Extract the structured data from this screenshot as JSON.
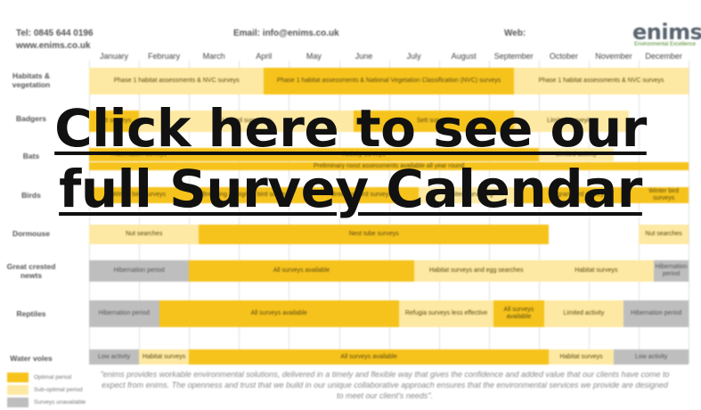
{
  "header": {
    "tel": "Tel: 0845 644 0196",
    "web_url": "www.enims.co.uk",
    "email": "Email: info@enims.co.uk",
    "web_label": "Web:",
    "logo": "enims",
    "logo_sub": "Environmental Excellence"
  },
  "months": [
    "January",
    "February",
    "March",
    "April",
    "May",
    "June",
    "July",
    "August",
    "September",
    "October",
    "November",
    "December"
  ],
  "rows": [
    {
      "label": "Habitats & vegetation",
      "cells": [
        {
          "text": "Phase 1 habitat assessments & NVC surveys",
          "kind": "s"
        },
        {
          "text": "Phase 1 habitat assessments & National Vegetation Classification (NVC) surveys",
          "kind": "o"
        },
        {
          "text": "Phase 1 habitat assessments & NVC surveys",
          "kind": "s"
        }
      ]
    },
    {
      "label": "Badgers",
      "cells": [
        {
          "text": "Sett surveys",
          "kind": "o"
        },
        {
          "text": "Limited surveying",
          "kind": "s"
        },
        {
          "text": "Sett surveys",
          "kind": "o"
        },
        {
          "text": "Limited surveying",
          "kind": "s"
        }
      ]
    },
    {
      "label": "Bats",
      "cells": [
        {
          "text": "Hibernation surveys",
          "kind": "o"
        },
        {
          "text": "Activity surveys",
          "kind": "o"
        },
        {
          "text": "Limited activity",
          "kind": "s"
        },
        {
          "text": "Preliminary roost assessments available all year round",
          "kind": "o"
        }
      ]
    },
    {
      "label": "Birds",
      "cells": [
        {
          "text": "Winter bird surveys",
          "kind": "o"
        },
        {
          "text": "Breeding & migrant bird surveys",
          "kind": "o"
        },
        {
          "text": "Breeding bird surveys",
          "kind": "o"
        },
        {
          "text": "Limited surveying",
          "kind": "s"
        },
        {
          "text": "Migrant bird surveys",
          "kind": "o"
        },
        {
          "text": "Winter bird surveys",
          "kind": "o"
        }
      ]
    },
    {
      "label": "Dormouse",
      "cells": [
        {
          "text": "Nut searches",
          "kind": "s"
        },
        {
          "text": "Nest tube surveys",
          "kind": "o"
        },
        {
          "text": "Nut searches",
          "kind": "s"
        }
      ]
    },
    {
      "label": "Great crested newts",
      "cells": [
        {
          "text": "Hibernation period",
          "kind": "u"
        },
        {
          "text": "All surveys available",
          "kind": "o"
        },
        {
          "text": "Habitat surveys and egg searches",
          "kind": "s"
        },
        {
          "text": "Habitat surveys",
          "kind": "s"
        },
        {
          "text": "Hibernation period",
          "kind": "u"
        }
      ]
    },
    {
      "label": "Reptiles",
      "cells": [
        {
          "text": "Hibernation period",
          "kind": "u"
        },
        {
          "text": "All surveys available",
          "kind": "o"
        },
        {
          "text": "Refugia surveys less effective",
          "kind": "s"
        },
        {
          "text": "All surveys available",
          "kind": "o"
        },
        {
          "text": "Limited activity",
          "kind": "s"
        },
        {
          "text": "Hibernation period",
          "kind": "u"
        }
      ]
    },
    {
      "label": "Water voles",
      "cells": [
        {
          "text": "Low activity",
          "kind": "u"
        },
        {
          "text": "Habitat surveys",
          "kind": "s"
        },
        {
          "text": "All surveys available",
          "kind": "o"
        },
        {
          "text": "Habitat surveys",
          "kind": "s"
        },
        {
          "text": "Low activity",
          "kind": "u"
        }
      ]
    }
  ],
  "key": [
    {
      "label": "Optimal period",
      "kind": "o"
    },
    {
      "label": "Sub-optimal period",
      "kind": "s"
    },
    {
      "label": "Surveys unavailable",
      "kind": "u"
    }
  ],
  "footer_text": "\"enims provides workable environmental solutions, delivered in a timely and flexible way that gives the confidence and added value that our clients have come to expect from enims. The openness and trust that we build in our unique collaborative approach ensures that the environmental services we provide are designed to meet our client's needs\".",
  "overlay": {
    "line1": "Click here to see our",
    "line2": "full Survey Calendar"
  },
  "colors": {
    "optimal": "#f6c31c",
    "sub_optimal": "#fde9a3",
    "unavailable": "#bebebe"
  }
}
